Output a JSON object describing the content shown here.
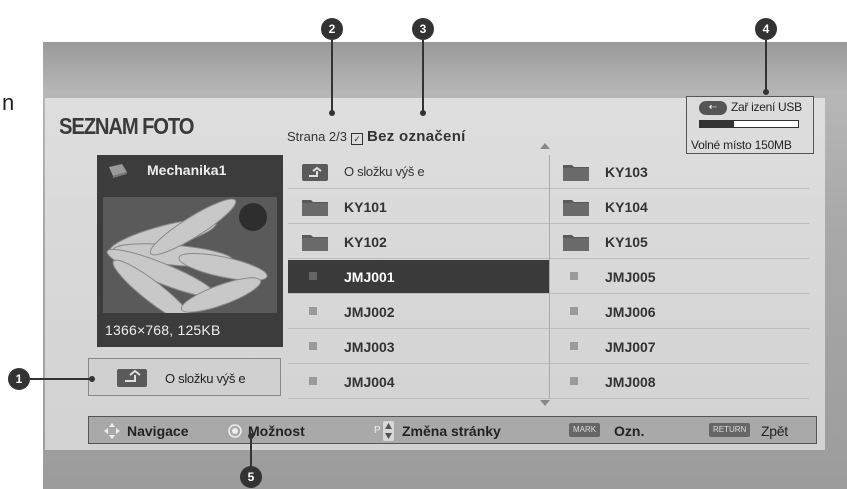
{
  "stray_text": "n",
  "title": "SEZNAM FOTO",
  "page": {
    "page_label": "Strana 2/3",
    "check_mark": "✓",
    "mark_label": "Bez označení"
  },
  "usb": {
    "badge": "⇠",
    "label": "Zař izení USB",
    "free_label": "Volné místo 150MB",
    "usage_fraction": 0.35
  },
  "preview": {
    "name": "Mechanika1",
    "info": "1366×768, 125KB"
  },
  "up_button": {
    "label": "O složku výš e"
  },
  "files_left": [
    {
      "name": "O složku výš e",
      "type": "up"
    },
    {
      "name": "KY101",
      "type": "folder"
    },
    {
      "name": "KY102",
      "type": "folder"
    },
    {
      "name": "JMJ001",
      "type": "photo",
      "selected": true
    },
    {
      "name": "JMJ002",
      "type": "photo"
    },
    {
      "name": "JMJ003",
      "type": "photo"
    },
    {
      "name": "JMJ004",
      "type": "photo"
    }
  ],
  "files_right": [
    {
      "name": "KY103",
      "type": "folder"
    },
    {
      "name": "KY104",
      "type": "folder"
    },
    {
      "name": "KY105",
      "type": "folder"
    },
    {
      "name": "JMJ005",
      "type": "photo"
    },
    {
      "name": "JMJ006",
      "type": "photo"
    },
    {
      "name": "JMJ007",
      "type": "photo"
    },
    {
      "name": "JMJ008",
      "type": "photo"
    }
  ],
  "footer": {
    "nav_label": "Navigace",
    "option_label": "Možnost",
    "page_key": "P",
    "page_label": "Změna stránky",
    "mark_key": "MARK",
    "mark_label": "Ozn.",
    "return_key": "RETURN",
    "return_label": "Zpět"
  },
  "callouts": [
    "1",
    "2",
    "3",
    "4",
    "5"
  ],
  "colors": {
    "selected_row": "#3a3a3a",
    "folder": "#5a5a5a",
    "callout": "#333333"
  }
}
